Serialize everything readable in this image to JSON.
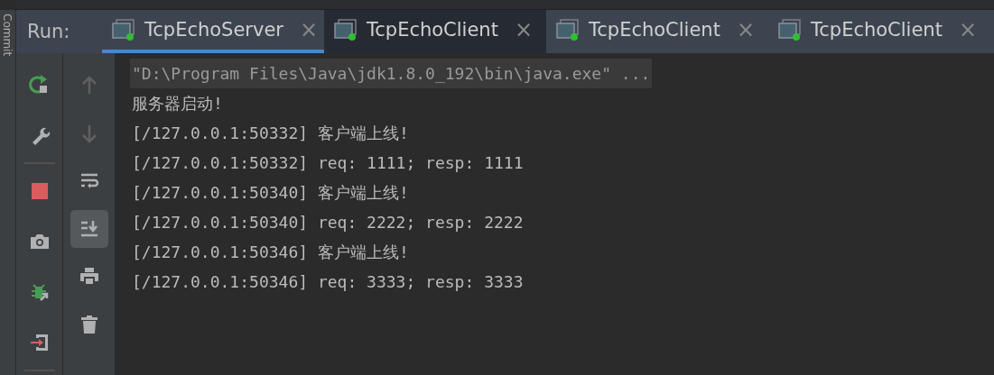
{
  "side_strip": {
    "label": "Commit"
  },
  "run_label": "Run:",
  "tabs": [
    {
      "label": "TcpEchoServer",
      "selected": true,
      "hovered": false,
      "close": "×"
    },
    {
      "label": "TcpEchoClient",
      "selected": false,
      "hovered": true,
      "close": "×"
    },
    {
      "label": "TcpEchoClient",
      "selected": false,
      "hovered": false,
      "close": "×"
    },
    {
      "label": "TcpEchoClient",
      "selected": false,
      "hovered": false,
      "close": "×"
    }
  ],
  "run_toolbar": [
    {
      "kind": "rerun"
    },
    {
      "kind": "wrench"
    },
    {
      "kind": "separator"
    },
    {
      "kind": "stop"
    },
    {
      "kind": "camera"
    },
    {
      "kind": "bug"
    },
    {
      "kind": "exit"
    },
    {
      "kind": "separator"
    }
  ],
  "console_toolbar": [
    {
      "kind": "up",
      "disabled": true,
      "selected": false
    },
    {
      "kind": "down",
      "disabled": true,
      "selected": false
    },
    {
      "kind": "wrap",
      "disabled": false,
      "selected": false
    },
    {
      "kind": "scroll-end",
      "disabled": false,
      "selected": true
    },
    {
      "kind": "print",
      "disabled": false,
      "selected": false
    },
    {
      "kind": "trash",
      "disabled": false,
      "selected": false
    }
  ],
  "console_lines": [
    {
      "kind": "command",
      "text": "\"D:\\Program Files\\Java\\jdk1.8.0_192\\bin\\java.exe\" ..."
    },
    {
      "kind": "output",
      "text": "服务器启动!"
    },
    {
      "kind": "output",
      "text": "[/127.0.0.1:50332] 客户端上线!"
    },
    {
      "kind": "output",
      "text": "[/127.0.0.1:50332] req: 1111; resp: 1111"
    },
    {
      "kind": "output",
      "text": "[/127.0.0.1:50340] 客户端上线!"
    },
    {
      "kind": "output",
      "text": "[/127.0.0.1:50340] req: 2222; resp: 2222"
    },
    {
      "kind": "output",
      "text": "[/127.0.0.1:50346] 客户端上线!"
    },
    {
      "kind": "output",
      "text": "[/127.0.0.1:50346] req: 3333; resp: 3333"
    }
  ]
}
